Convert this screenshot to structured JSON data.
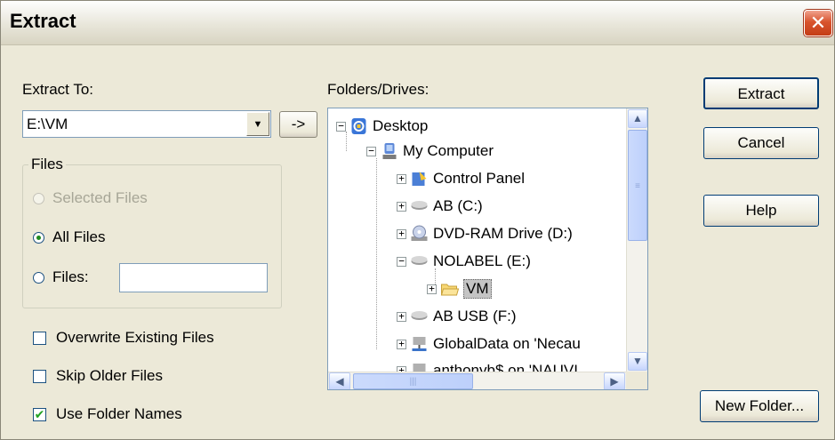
{
  "dialog": {
    "title": "Extract",
    "close_glyph": "✕"
  },
  "extract_to": {
    "label": "Extract To:",
    "value": "E:\\VM",
    "arrow_button": "->"
  },
  "files_group": {
    "legend": "Files",
    "options": [
      {
        "label": "Selected Files",
        "enabled": false,
        "selected": false
      },
      {
        "label": "All Files",
        "enabled": true,
        "selected": true
      },
      {
        "label": "Files:",
        "enabled": true,
        "selected": false
      }
    ],
    "files_input_value": ""
  },
  "checkboxes": [
    {
      "label": "Overwrite Existing Files",
      "checked": false
    },
    {
      "label": "Skip Older Files",
      "checked": false
    },
    {
      "label": "Use Folder Names",
      "checked": true
    }
  ],
  "folders": {
    "label": "Folders/Drives:",
    "items": [
      {
        "label": "Desktop",
        "expander": "−",
        "icon": "desktop-icon"
      },
      {
        "label": "My Computer",
        "expander": "−",
        "icon": "computer-icon"
      },
      {
        "label": "Control Panel",
        "expander": "+",
        "icon": "control-panel-icon"
      },
      {
        "label": "AB  (C:)",
        "expander": "+",
        "icon": "hard-drive-icon"
      },
      {
        "label": "DVD-RAM Drive (D:)",
        "expander": "+",
        "icon": "dvd-drive-icon"
      },
      {
        "label": "NOLABEL (E:)",
        "expander": "−",
        "icon": "hard-drive-icon"
      },
      {
        "label": "VM",
        "expander": "+",
        "icon": "folder-icon",
        "selected": true
      },
      {
        "label": "AB USB (F:)",
        "expander": "+",
        "icon": "hard-drive-icon"
      },
      {
        "label": "GlobalData on 'Necau",
        "expander": "+",
        "icon": "network-drive-icon"
      },
      {
        "label": "anthonyb$ on 'NAUVI",
        "expander": "+",
        "icon": "network-drive-icon"
      }
    ]
  },
  "buttons": {
    "extract": "Extract",
    "cancel": "Cancel",
    "help": "Help",
    "new_folder": "New Folder..."
  },
  "colors": {
    "dialog_bg": "#ece9d8",
    "close_red": "#d8542e",
    "accent_blue": "#7f9db9"
  }
}
